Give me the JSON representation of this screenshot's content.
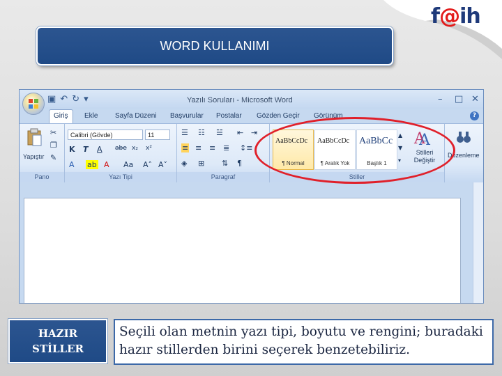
{
  "slide": {
    "title": "WORD KULLANIMI",
    "logo_text_a": "f",
    "logo_text_at": "@",
    "logo_text_b": "ih",
    "label_box": "HAZIR STİLLER",
    "description": "Seçili olan metnin yazı tipi, boyutu ve rengini; buradaki hazır stillerden birini seçerek benzetebiliriz.",
    "highlight_color": "#e0202a"
  },
  "word": {
    "window_title": "Yazılı Soruları - Microsoft Word",
    "tabs": [
      "Giriş",
      "Ekle",
      "Sayfa Düzeni",
      "Başvurular",
      "Postalar",
      "Gözden Geçir",
      "Görünüm"
    ],
    "active_tab": "Giriş",
    "groups": {
      "clipboard": {
        "label": "Pano",
        "paste_label": "Yapıştır"
      },
      "font": {
        "label": "Yazı Tipi",
        "font_name": "Calibri (Gövde)",
        "font_size": "11"
      },
      "paragraph": {
        "label": "Paragraf"
      },
      "styles": {
        "label": "Stiller",
        "items": [
          {
            "sample": "AaBbCcDc",
            "name": "¶ Normal"
          },
          {
            "sample": "AaBbCcDc",
            "name": "¶ Aralık Yok"
          },
          {
            "sample": "AaBbCc",
            "name": "Başlık 1"
          }
        ],
        "change_styles": "Stilleri Değiştir"
      },
      "editing": {
        "label": "Düzenleme"
      }
    }
  }
}
